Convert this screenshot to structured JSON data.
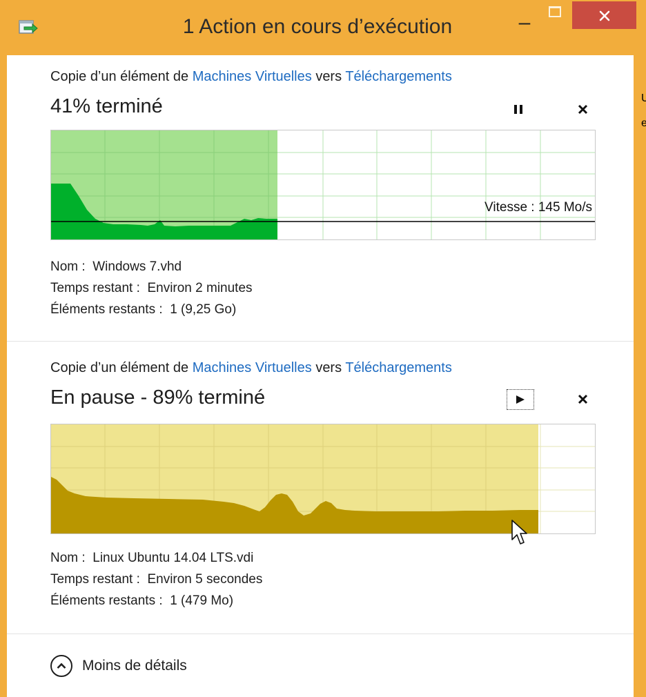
{
  "window": {
    "title": "1 Action en cours d’exécution",
    "accent_color": "#f2ad3c",
    "close_color": "#c94c41"
  },
  "operations": [
    {
      "copy_prefix": "Copie d’un élément de",
      "source": "Machines Virtuelles",
      "connector": "vers",
      "destination": "Téléchargements",
      "status": "41% terminé",
      "progress": 0.41,
      "speed_label": "Vitesse : 145 Mo/s",
      "control_icon": "pause-icon",
      "cancel_icon": "close-icon",
      "graph_color": "#00b02b",
      "graph_bg_color": "#a5e18f",
      "details": {
        "name_label": "Nom :",
        "name_value": "Windows 7.vhd",
        "time_label": "Temps restant :",
        "time_value": "Environ 2 minutes",
        "items_label": "Éléments restants :",
        "items_value": "1 (9,25 Go)"
      }
    },
    {
      "copy_prefix": "Copie d’un élément de",
      "source": "Machines Virtuelles",
      "connector": "vers",
      "destination": "Téléchargements",
      "status": "En pause - 89% terminé",
      "progress": 0.89,
      "control_icon": "play-icon",
      "cancel_icon": "close-icon",
      "graph_color": "#b99600",
      "graph_bg_color": "#efe48f",
      "details": {
        "name_label": "Nom :",
        "name_value": "Linux Ubuntu 14.04 LTS.vdi",
        "time_label": "Temps restant :",
        "time_value": "Environ 5 secondes",
        "items_label": "Éléments restants :",
        "items_value": "1 (479 Mo)"
      }
    }
  ],
  "footer": {
    "toggle_label": "Moins de détails",
    "toggle_icon": "chevron-up-icon"
  },
  "edge_fragments": [
    "U",
    "e"
  ]
}
